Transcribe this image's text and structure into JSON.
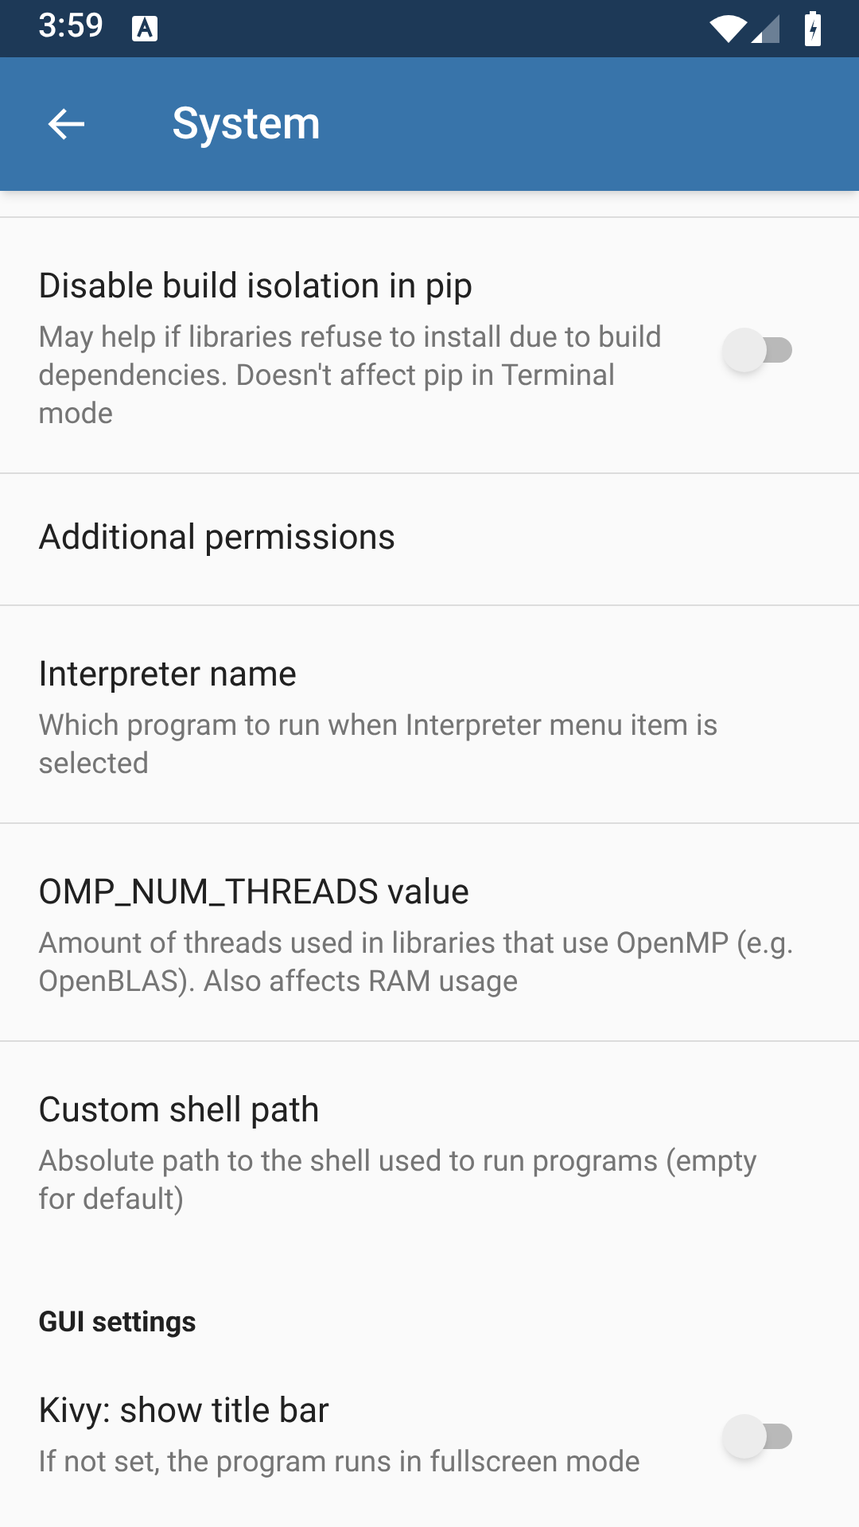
{
  "status_bar": {
    "time": "3:59"
  },
  "app_bar": {
    "title": "System"
  },
  "items": [
    {
      "kind": "switch",
      "title": "Disable build isolation in pip",
      "summary": "May help if libraries refuse to install due to build dependencies. Doesn't affect pip in Terminal mode",
      "on": false
    },
    {
      "kind": "plain",
      "title": "Additional permissions"
    },
    {
      "kind": "plain",
      "title": "Interpreter name",
      "summary": "Which program to run when Interpreter menu item is selected"
    },
    {
      "kind": "plain",
      "title": "OMP_NUM_THREADS value",
      "summary": "Amount of threads used in libraries that use OpenMP (e.g. OpenBLAS). Also affects RAM usage"
    },
    {
      "kind": "plain",
      "title": "Custom shell path",
      "summary": "Absolute path to the shell used to run programs (empty for default)"
    },
    {
      "kind": "category",
      "title": "GUI settings"
    },
    {
      "kind": "switch",
      "title": "Kivy: show title bar",
      "summary": "If not set, the program runs in fullscreen mode",
      "on": false
    }
  ]
}
